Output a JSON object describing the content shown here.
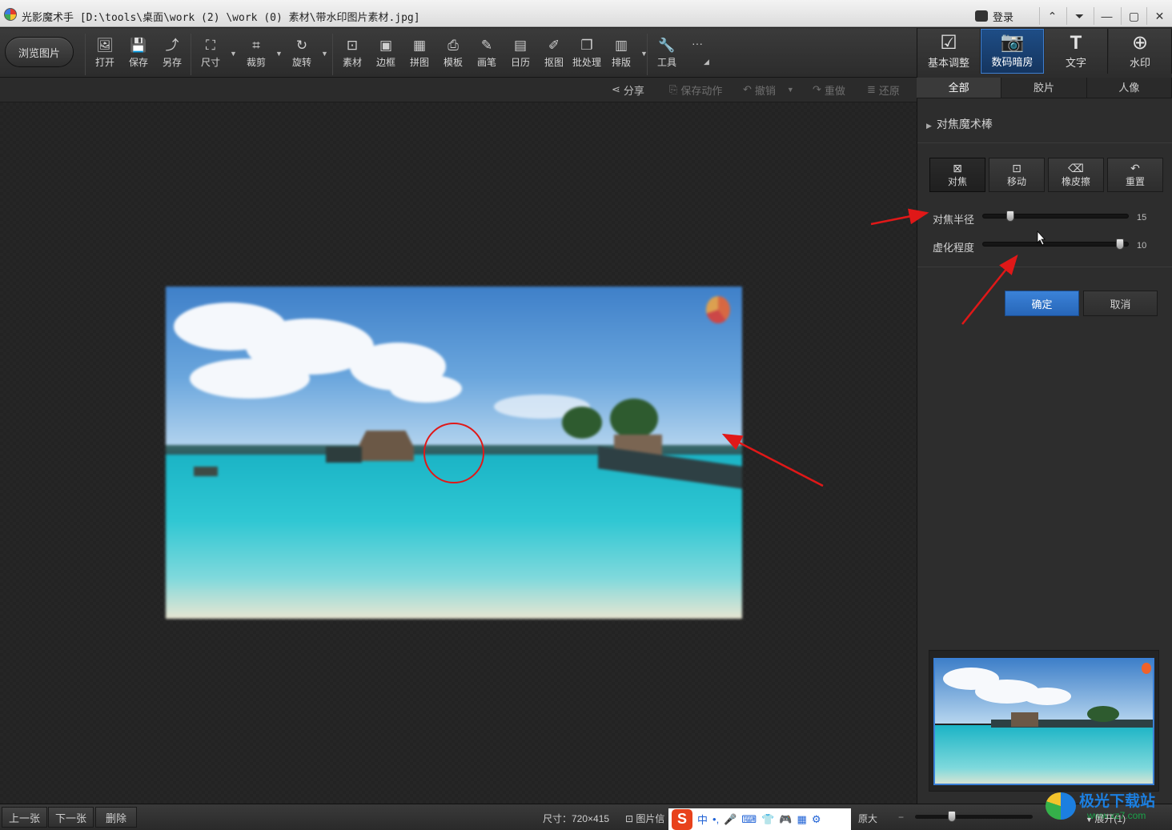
{
  "window": {
    "title": "光影魔术手  [D:\\tools\\桌面\\work (2) \\work (0) 素材\\带水印图片素材.jpg]",
    "login": "登录",
    "controls": [
      "⌃",
      "⏷",
      "—",
      "▢",
      "✕"
    ]
  },
  "toolbar": {
    "browse": "浏览图片",
    "tools": [
      {
        "label": "打开",
        "icon": "open-icon"
      },
      {
        "label": "保存",
        "icon": "save-icon"
      },
      {
        "label": "另存",
        "icon": "save-as-icon"
      },
      {
        "label": "尺寸",
        "icon": "resize-icon"
      },
      {
        "label": "裁剪",
        "icon": "crop-icon"
      },
      {
        "label": "旋转",
        "icon": "rotate-icon"
      },
      {
        "label": "素材",
        "icon": "material-icon"
      },
      {
        "label": "边框",
        "icon": "border-icon"
      },
      {
        "label": "拼图",
        "icon": "collage-icon"
      },
      {
        "label": "模板",
        "icon": "template-icon"
      },
      {
        "label": "画笔",
        "icon": "brush-icon"
      },
      {
        "label": "日历",
        "icon": "calendar-icon"
      },
      {
        "label": "抠图",
        "icon": "cutout-icon"
      },
      {
        "label": "批处理",
        "icon": "batch-icon"
      },
      {
        "label": "排版",
        "icon": "layout-icon"
      },
      {
        "label": "工具",
        "icon": "tools-icon"
      }
    ],
    "more": "···"
  },
  "subbar": {
    "share": "分享",
    "save_action": "保存动作",
    "undo": "撤销",
    "redo": "重做",
    "restore": "还原"
  },
  "right_panel": {
    "tabs": [
      {
        "label": "基本调整",
        "icon": "adjust-icon"
      },
      {
        "label": "数码暗房",
        "icon": "darkroom-icon"
      },
      {
        "label": "文字",
        "icon": "text-icon"
      },
      {
        "label": "水印",
        "icon": "watermark-icon"
      }
    ],
    "active_tab": "数码暗房",
    "subtabs": [
      "全部",
      "胶片",
      "人像"
    ],
    "active_subtab": "全部",
    "section_title": "对焦魔术棒",
    "buttons": [
      {
        "label": "对焦",
        "icon": "focus-icon"
      },
      {
        "label": "移动",
        "icon": "move-icon"
      },
      {
        "label": "橡皮擦",
        "icon": "eraser-icon"
      },
      {
        "label": "重置",
        "icon": "reset-icon"
      }
    ],
    "sliders": [
      {
        "label": "对焦半径",
        "value": "15",
        "level": 0.17
      },
      {
        "label": "虚化程度",
        "value": "10",
        "level": 0.97
      }
    ],
    "ok": "确定",
    "cancel": "取消"
  },
  "statusbar": {
    "prev": "上一张",
    "next": "下一张",
    "delete": "删除",
    "size": "尺寸：720×415",
    "info": "图片信",
    "original": "原大",
    "expand": "展开(1)",
    "zoom_level": 0.3
  },
  "ime": {
    "items": [
      "中",
      "•,",
      "🎤",
      "⌨",
      "👕",
      "🎮",
      "▦",
      "⚙"
    ]
  },
  "site_mark": {
    "name": "极光下载站",
    "url": "www.xz7.com"
  },
  "colors": {
    "accent": "#2f74c9",
    "annotation": "#e01818"
  }
}
